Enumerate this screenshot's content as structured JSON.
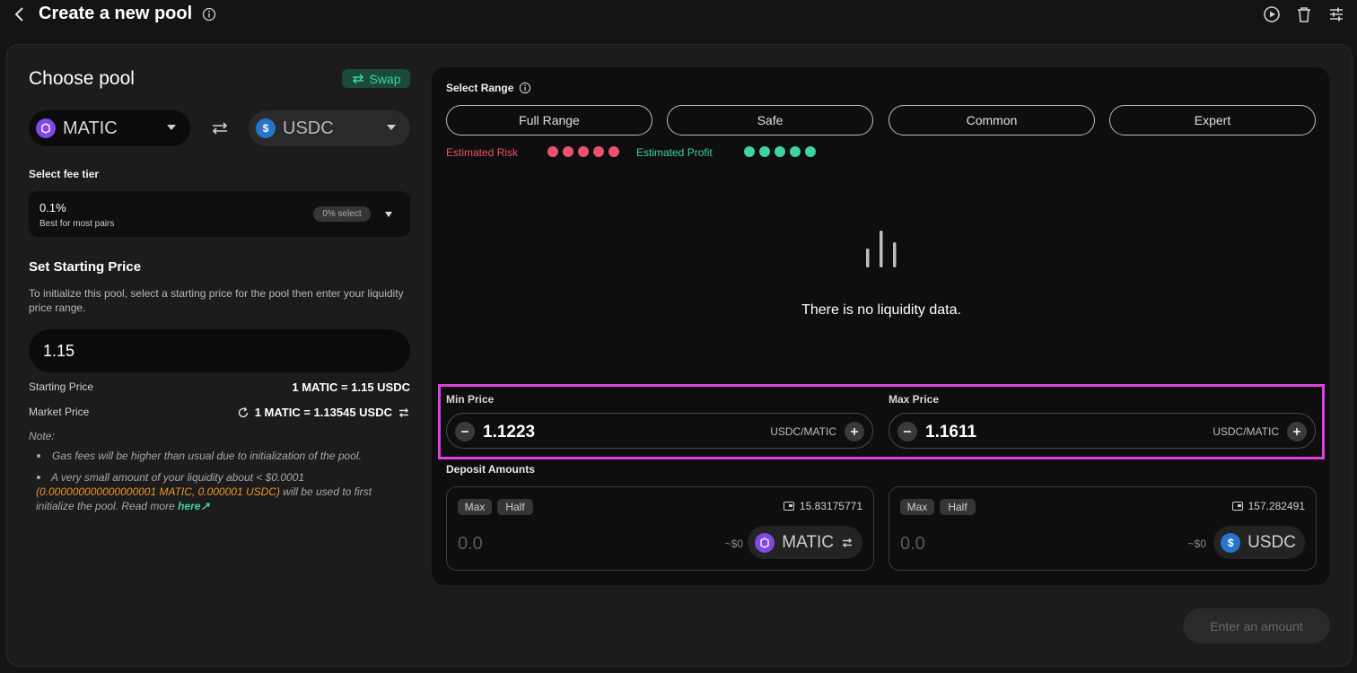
{
  "header": {
    "title": "Create a new pool"
  },
  "choose_pool": {
    "title": "Choose pool",
    "swap_label": "Swap",
    "token_a": "MATIC",
    "token_b": "USDC"
  },
  "fee_tier": {
    "label": "Select fee tier",
    "value": "0.1%",
    "description": "Best for most pairs",
    "badge": "0% select"
  },
  "starting_price": {
    "title": "Set Starting Price",
    "description": "To initialize this pool, select a starting price for the pool then enter your liquidity price range.",
    "input_value": "1.15",
    "starting_label": "Starting Price",
    "starting_value": "1 MATIC = 1.15 USDC",
    "market_label": "Market Price",
    "market_value": "1 MATIC = 1.13545 USDC"
  },
  "note": {
    "title": "Note:",
    "item1": "Gas fees will be higher than usual due to initialization of the pool.",
    "item2_a": "A very small amount of your liquidity about < $0.0001",
    "item2_b": "(0.000000000000000001 MATIC, 0.000001 USDC)",
    "item2_c": " will be used to first initialize the pool. Read more ",
    "item2_link": "here↗"
  },
  "range": {
    "title": "Select Range",
    "options": [
      "Full Range",
      "Safe",
      "Common",
      "Expert"
    ],
    "risk_label": "Estimated Risk",
    "profit_label": "Estimated Profit",
    "risk_color": "#f0506e",
    "profit_color": "#3fd49e",
    "risk_level": 5,
    "profit_level": 5
  },
  "liquidity": {
    "empty_text": "There is no liquidity data."
  },
  "min_price": {
    "label": "Min Price",
    "value": "1.1223",
    "unit": "USDC/MATIC"
  },
  "max_price": {
    "label": "Max Price",
    "value": "1.1611",
    "unit": "USDC/MATIC"
  },
  "deposit": {
    "title": "Deposit Amounts",
    "max_label": "Max",
    "half_label": "Half",
    "matic": {
      "balance": "15.83175771",
      "amount": "0.0",
      "usd": "~$0",
      "token": "MATIC"
    },
    "usdc": {
      "balance": "157.282491",
      "amount": "0.0",
      "usd": "~$0",
      "token": "USDC"
    }
  },
  "submit_label": "Enter an amount",
  "colors": {
    "accent": "#3fd49e",
    "highlight": "#e040e0",
    "warning": "#f0932b"
  }
}
